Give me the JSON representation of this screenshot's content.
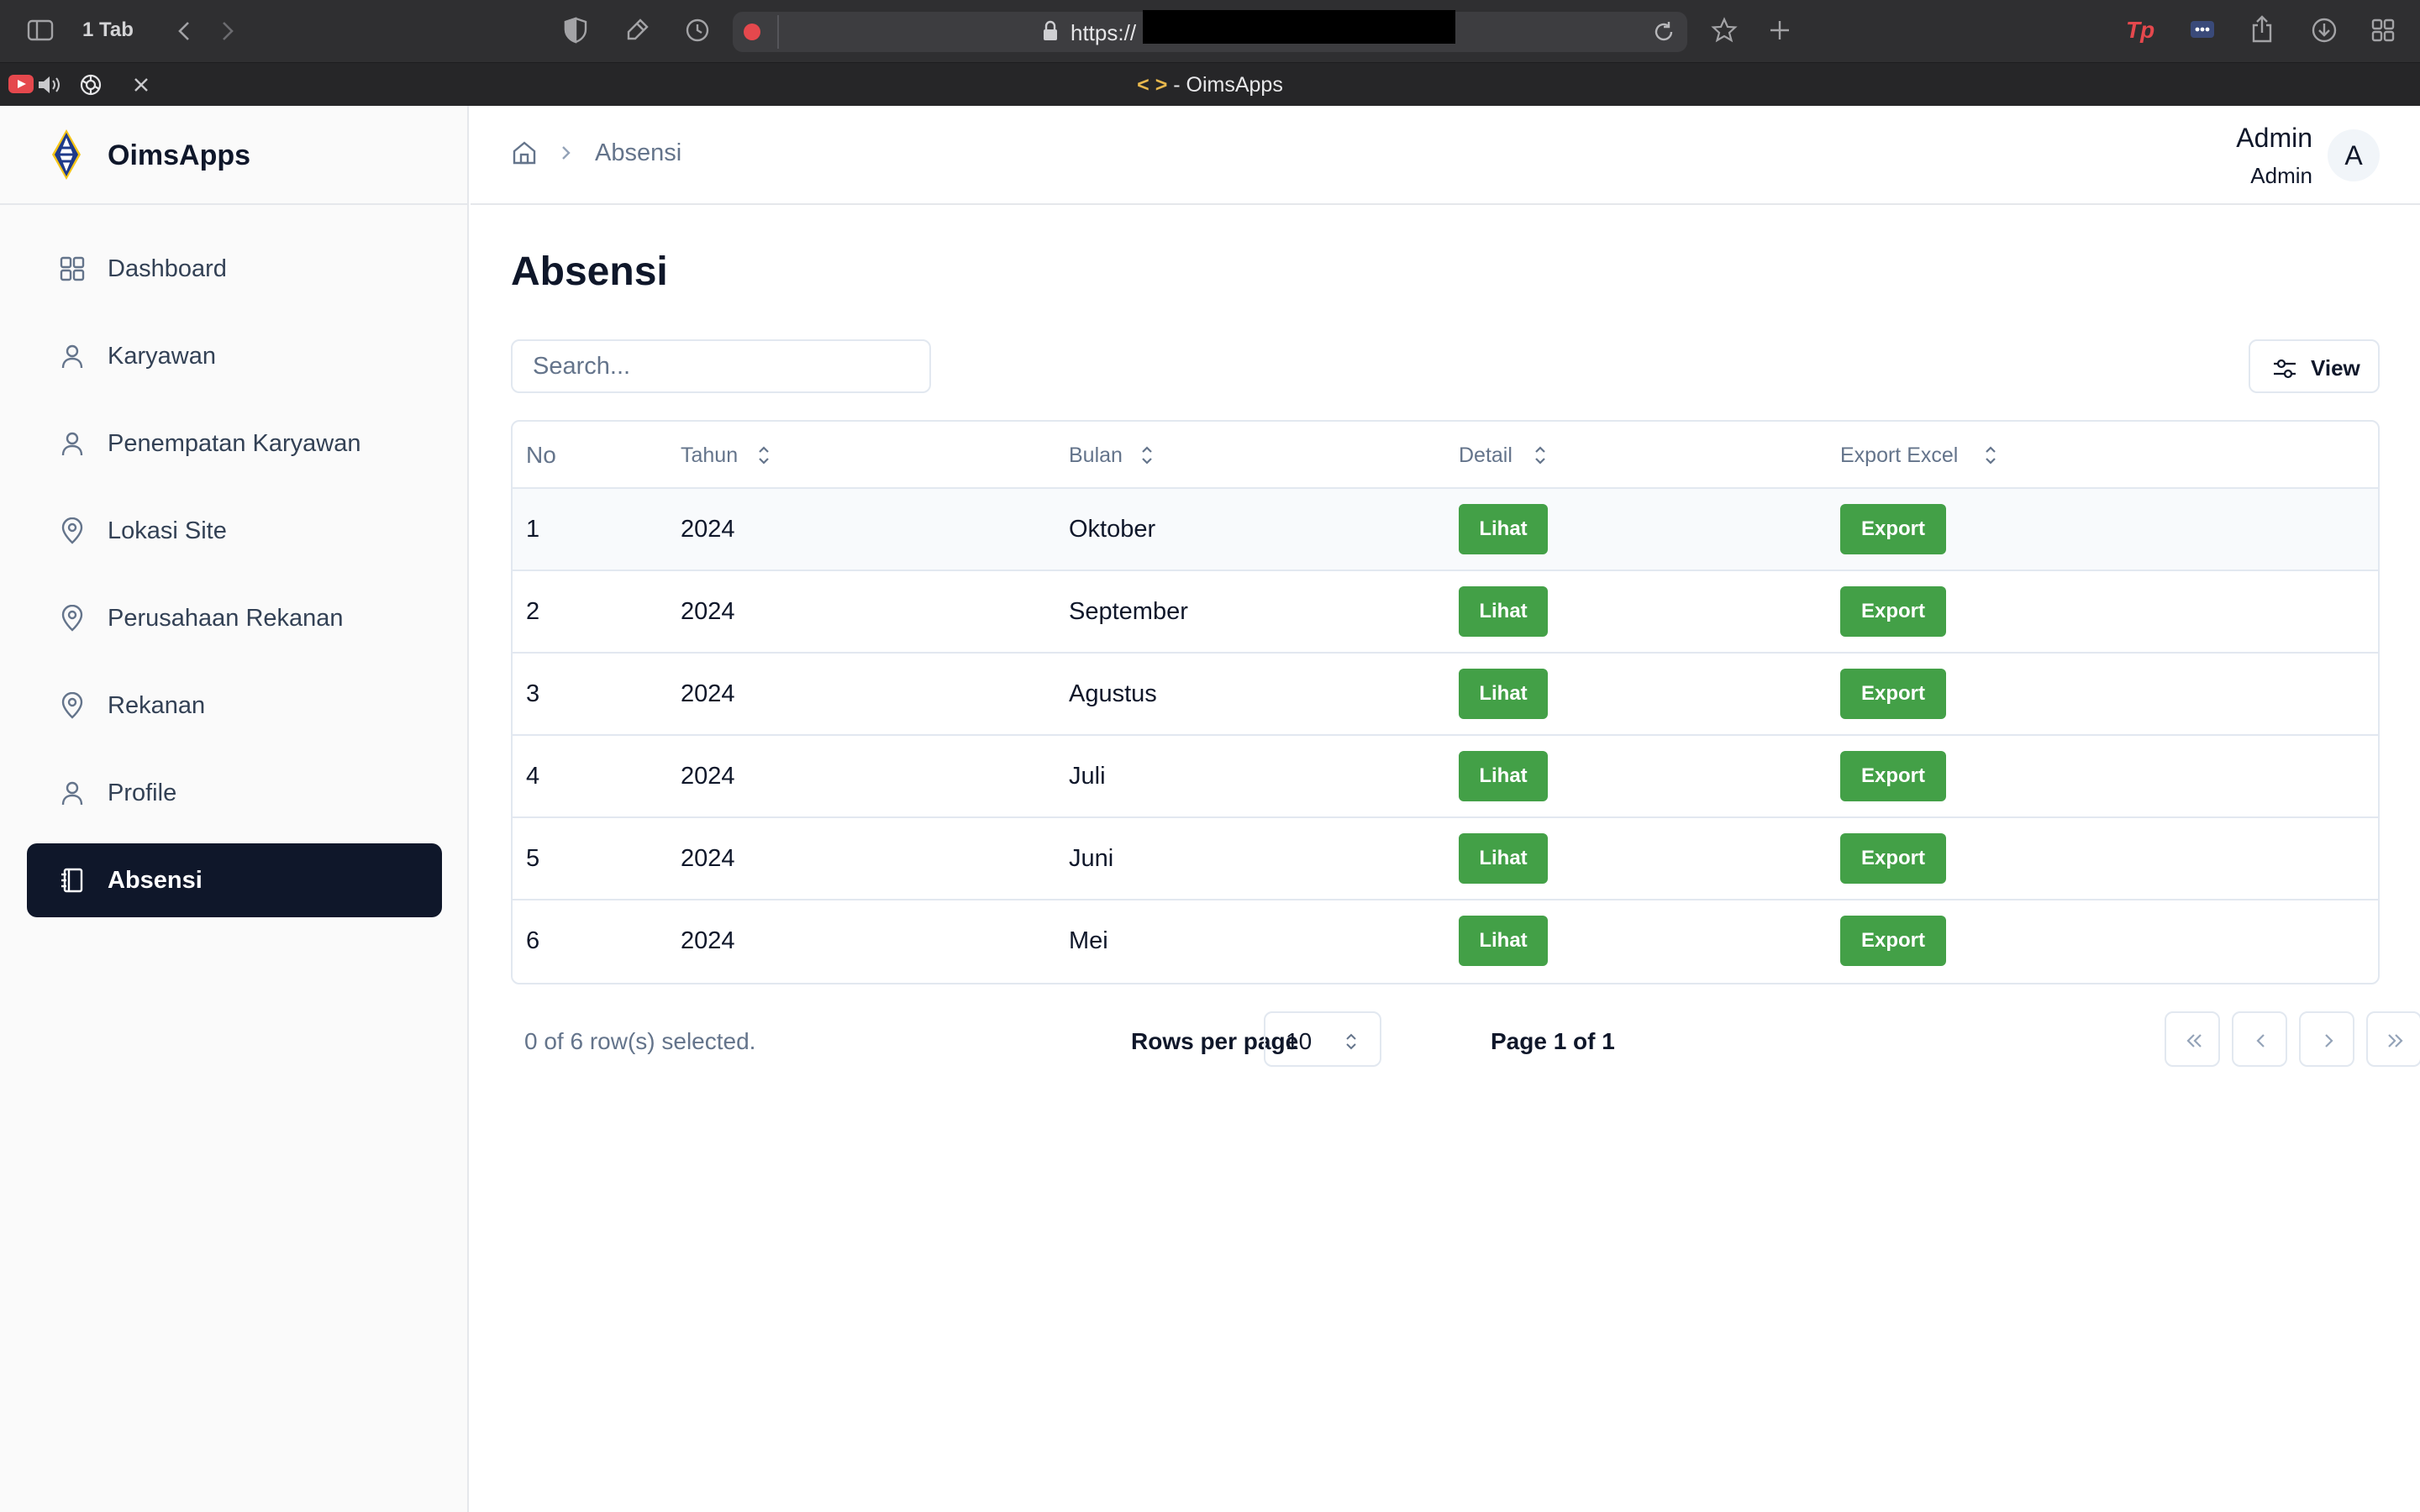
{
  "browser": {
    "tab_count": "1 Tab",
    "url": "https://",
    "active_tab_title_code": "< >",
    "active_tab_title": " - OimsApps"
  },
  "app": {
    "brand": "OimsApps"
  },
  "sidebar": {
    "items": [
      {
        "label": "Dashboard",
        "icon": "grid-icon"
      },
      {
        "label": "Karyawan",
        "icon": "user-icon"
      },
      {
        "label": "Penempatan Karyawan",
        "icon": "user-icon"
      },
      {
        "label": "Lokasi Site",
        "icon": "map-pin-icon"
      },
      {
        "label": "Perusahaan Rekanan",
        "icon": "map-pin-icon"
      },
      {
        "label": "Rekanan",
        "icon": "map-pin-icon"
      },
      {
        "label": "Profile",
        "icon": "user-icon"
      },
      {
        "label": "Absensi",
        "icon": "notebook-icon",
        "active": true
      }
    ]
  },
  "header": {
    "breadcrumb_current": "Absensi",
    "user_name": "Admin",
    "user_role": "Admin",
    "avatar_initial": "A"
  },
  "main": {
    "title": "Absensi",
    "search_placeholder": "Search...",
    "view_label": "View"
  },
  "table": {
    "columns": [
      "No",
      "Tahun",
      "Bulan",
      "Detail",
      "Export Excel"
    ],
    "rows": [
      {
        "no": "1",
        "tahun": "2024",
        "bulan": "Oktober",
        "detail": "Lihat",
        "export": "Export"
      },
      {
        "no": "2",
        "tahun": "2024",
        "bulan": "September",
        "detail": "Lihat",
        "export": "Export"
      },
      {
        "no": "3",
        "tahun": "2024",
        "bulan": "Agustus",
        "detail": "Lihat",
        "export": "Export"
      },
      {
        "no": "4",
        "tahun": "2024",
        "bulan": "Juli",
        "detail": "Lihat",
        "export": "Export"
      },
      {
        "no": "5",
        "tahun": "2024",
        "bulan": "Juni",
        "detail": "Lihat",
        "export": "Export"
      },
      {
        "no": "6",
        "tahun": "2024",
        "bulan": "Mei",
        "detail": "Lihat",
        "export": "Export"
      }
    ]
  },
  "pagination": {
    "selected_text": "0 of 6 row(s) selected.",
    "rows_per_page_label": "Rows per page",
    "rows_per_page_value": "10",
    "page_info": "Page 1 of 1"
  },
  "colors": {
    "action_green": "#43a047",
    "sidebar_active": "#0f172a",
    "record_red": "#e5484d"
  }
}
